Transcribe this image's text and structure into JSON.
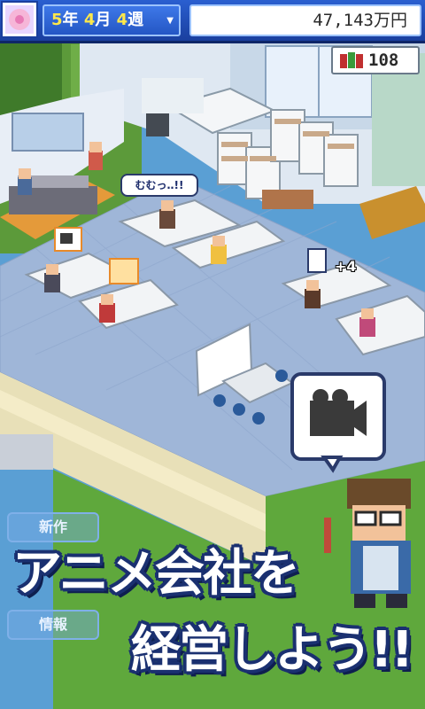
{
  "header": {
    "date_year": "5",
    "date_year_unit": "年",
    "date_month": "4",
    "date_month_unit": "月",
    "date_week": "4",
    "date_week_unit": "週",
    "money": "47,143万円"
  },
  "points": {
    "value": "108"
  },
  "speech": {
    "worker_text": "むむっ‥!!",
    "plus_text": "+4"
  },
  "side_menu": {
    "item1": "新作",
    "item2": "情報"
  },
  "title": {
    "line1": "アニメ会社を",
    "line2": "経営しよう!!"
  },
  "colors": {
    "header_blue": "#1a3f9e",
    "title_outline": "#1a3070",
    "accent_yellow": "#ffe84a"
  }
}
